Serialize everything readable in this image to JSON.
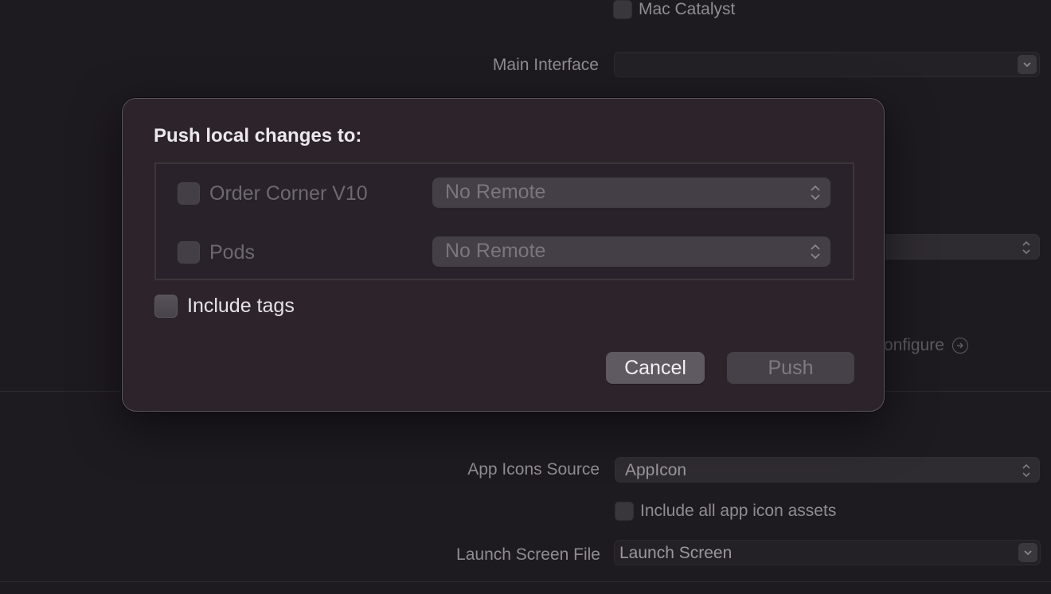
{
  "background": {
    "mac_catalyst": {
      "label": "Mac Catalyst",
      "checked": false
    },
    "main_interface": {
      "label": "Main Interface",
      "value": ""
    },
    "hidden_popup": {
      "value": ""
    },
    "configure_link": {
      "label": "onfigure",
      "icon": "circle-arrow-right-icon"
    },
    "app_icons_source": {
      "label": "App Icons Source",
      "value": "AppIcon"
    },
    "include_all_app_icon_assets": {
      "label": "Include all app icon assets",
      "checked": false
    },
    "launch_screen_file": {
      "label": "Launch Screen File",
      "value": "Launch Screen"
    }
  },
  "sheet": {
    "title": "Push local changes to:",
    "repositories": [
      {
        "name": "Order Corner V10",
        "checked": false,
        "remote": "No Remote"
      },
      {
        "name": "Pods",
        "checked": false,
        "remote": "No Remote"
      }
    ],
    "include_tags": {
      "label": "Include tags",
      "checked": false
    },
    "buttons": {
      "cancel": "Cancel",
      "push": "Push"
    }
  }
}
